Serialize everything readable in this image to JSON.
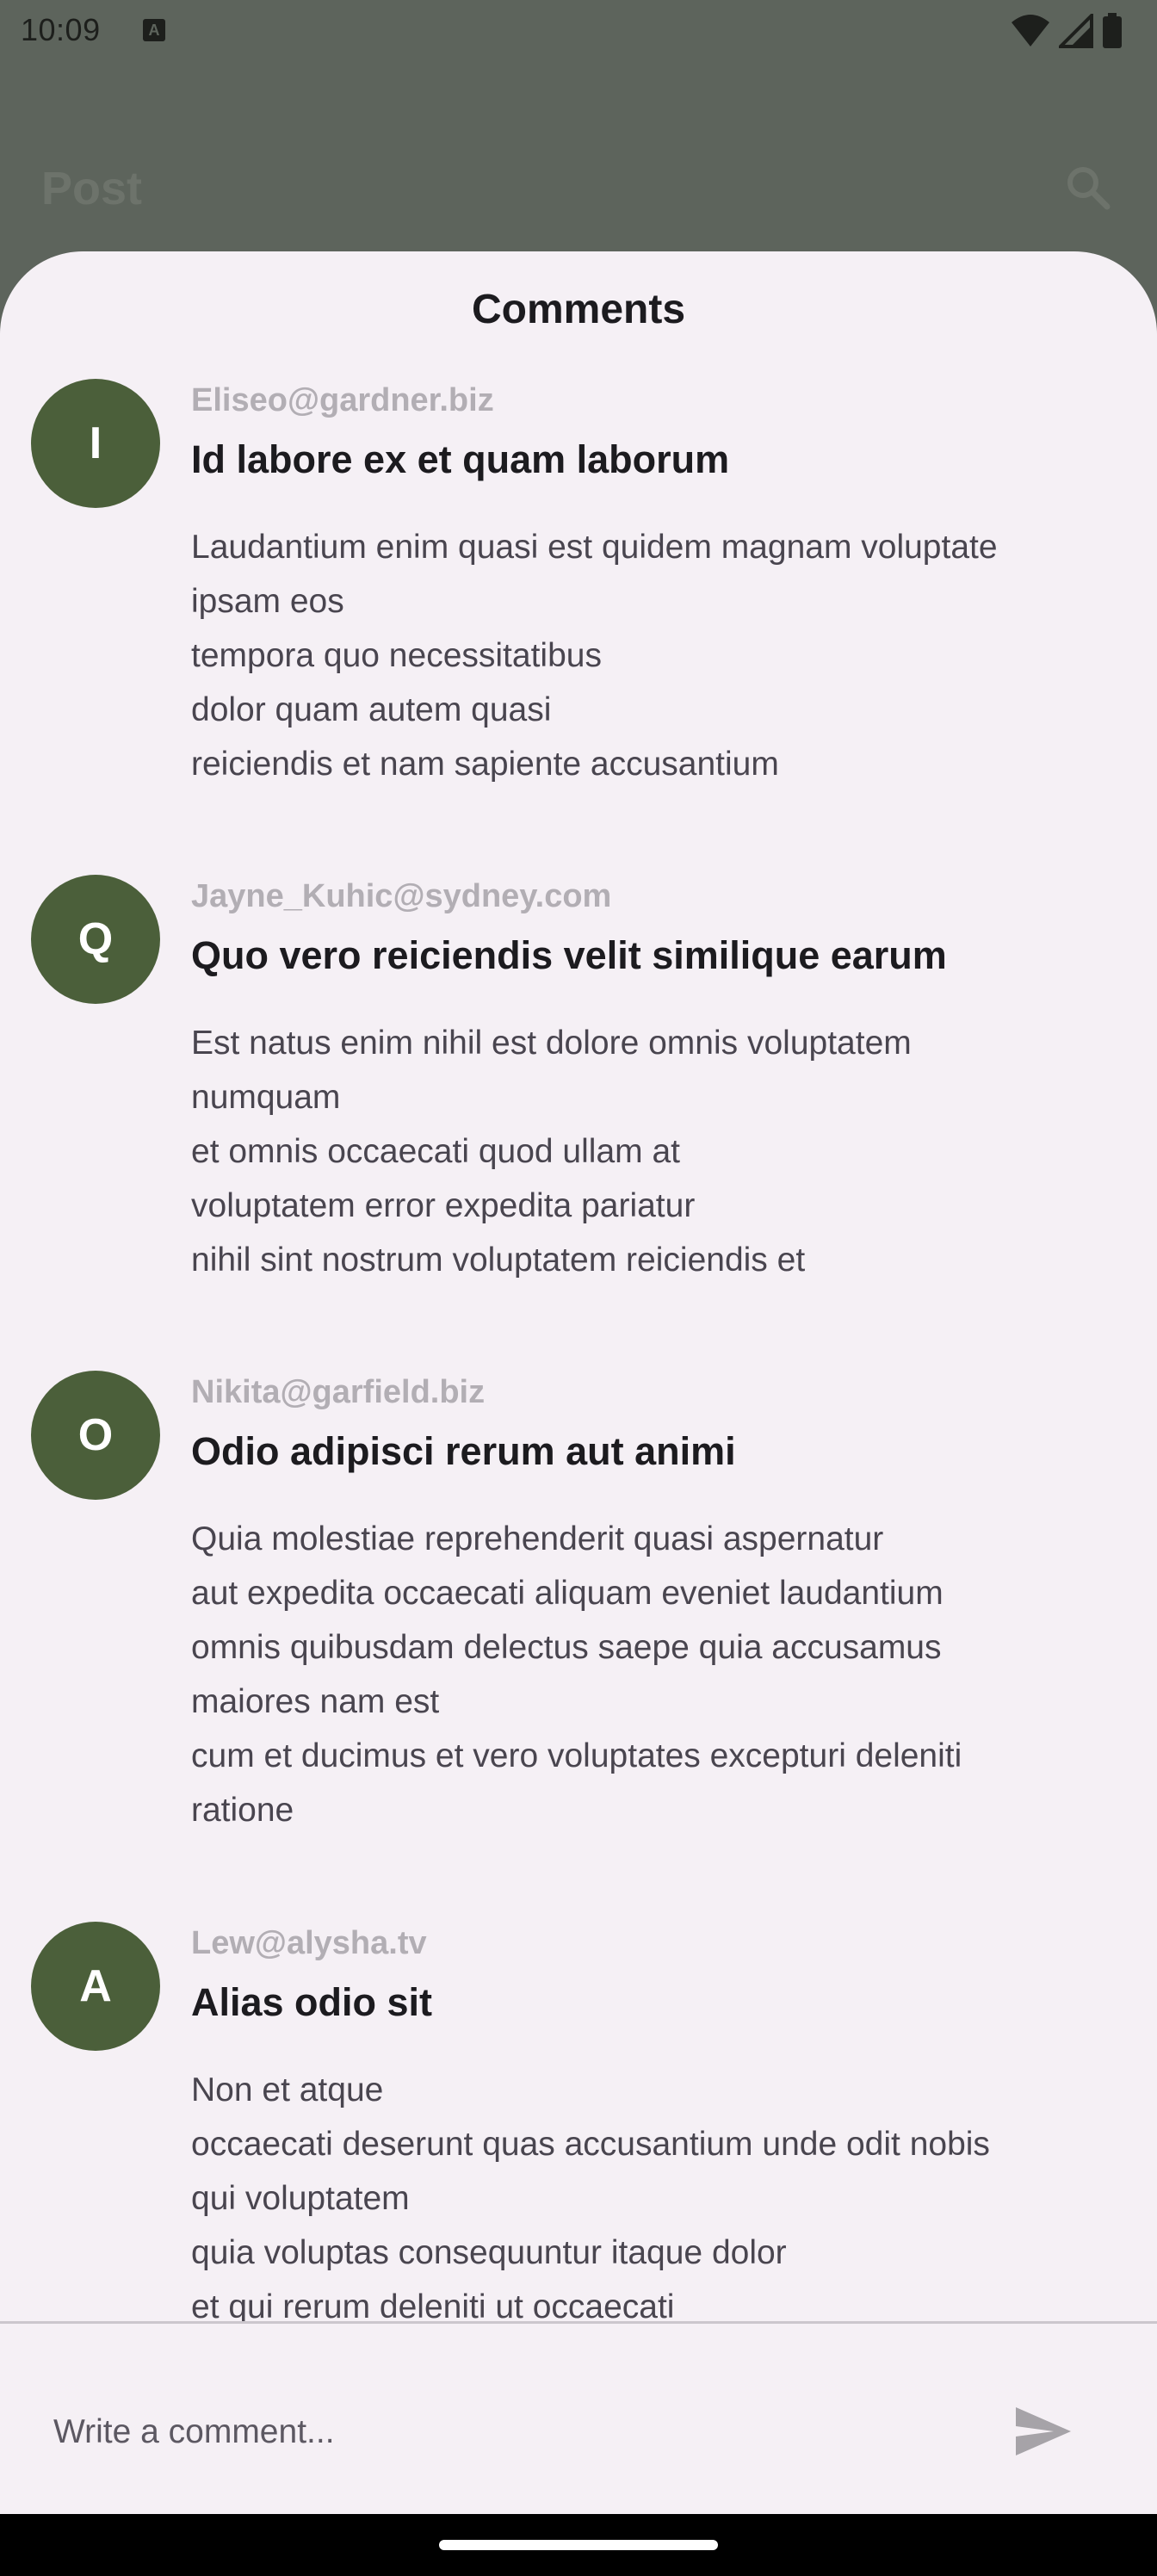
{
  "status_bar": {
    "time": "10:09",
    "notification_icon": "text-a-icon",
    "icons": [
      "wifi-icon",
      "signal-icon",
      "battery-icon"
    ]
  },
  "app_bar": {
    "title": "Post",
    "search_icon": "search-icon"
  },
  "sheet": {
    "title": "Comments",
    "comments": [
      {
        "initial": "I",
        "email": "Eliseo@gardner.biz",
        "title": "Id labore ex et quam laborum",
        "body_lines": [
          "Laudantium enim quasi est quidem magnam voluptate",
          "ipsam eos",
          "tempora quo necessitatibus",
          "dolor quam autem quasi",
          "reiciendis et nam sapiente accusantium"
        ]
      },
      {
        "initial": "Q",
        "email": "Jayne_Kuhic@sydney.com",
        "title": "Quo vero reiciendis velit similique earum",
        "body_lines": [
          "Est natus enim nihil est dolore omnis voluptatem",
          "numquam",
          "et omnis occaecati quod ullam at",
          "voluptatem error expedita pariatur",
          "nihil sint nostrum voluptatem reiciendis et"
        ]
      },
      {
        "initial": "O",
        "email": "Nikita@garfield.biz",
        "title": "Odio adipisci rerum aut animi",
        "body_lines": [
          "Quia molestiae reprehenderit quasi aspernatur",
          "aut expedita occaecati aliquam eveniet laudantium",
          "omnis quibusdam delectus saepe quia accusamus",
          "maiores nam est",
          "cum et ducimus et vero voluptates excepturi deleniti",
          "ratione"
        ]
      },
      {
        "initial": "A",
        "email": "Lew@alysha.tv",
        "title": "Alias odio sit",
        "body_lines": [
          "Non et atque",
          "occaecati deserunt quas accusantium unde odit nobis",
          "qui voluptatem",
          "quia voluptas consequuntur itaque dolor",
          "et qui rerum deleniti ut occaecati"
        ]
      }
    ],
    "input": {
      "value": "",
      "placeholder": "Write a comment..."
    },
    "send_icon": "send-icon"
  },
  "colors": {
    "scrim": "#5d645c",
    "sheet_background": "#f5f0f5",
    "avatar": "#4b5f3a",
    "email_text": "#b2aeb4",
    "send_icon": "#a6a3a8"
  }
}
